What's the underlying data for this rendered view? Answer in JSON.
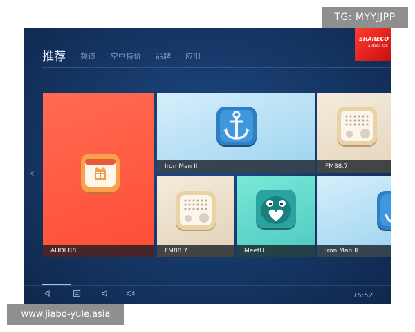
{
  "overlays": {
    "top_badge": "TG: MYYJJPP",
    "bottom_badge": "www.jiabo-yule.asia"
  },
  "brand": {
    "name": "SHARECO",
    "subtitle": "airbox OS"
  },
  "nav": {
    "items": [
      "推荐",
      "频道",
      "空中特价",
      "品牌",
      "应用"
    ],
    "active_index": 0
  },
  "tiles": [
    {
      "label": "AUDI R8",
      "icon": "gift-calendar-icon"
    },
    {
      "label": "Iron Man II",
      "icon": "anchor-icon"
    },
    {
      "label": "FM88.7",
      "icon": "radio-icon"
    },
    {
      "label": "FM88.7",
      "icon": "radio-icon"
    },
    {
      "label": "MeetU",
      "icon": "heart-monster-icon"
    },
    {
      "label": "Iron Man II",
      "icon": "anchor-icon"
    }
  ],
  "bottom_bar": {
    "icons": [
      "back-icon",
      "menu-icon",
      "volume-down-icon",
      "volume-up-icon"
    ],
    "time": "16:52"
  },
  "colors": {
    "screen_bg": "#173a6b",
    "brand_red": "#e8201a",
    "tile_orange": "#ff5a40",
    "tile_sky": "#b8e2f7",
    "tile_beige": "#ece0cc",
    "tile_teal": "#5fd8cc"
  }
}
